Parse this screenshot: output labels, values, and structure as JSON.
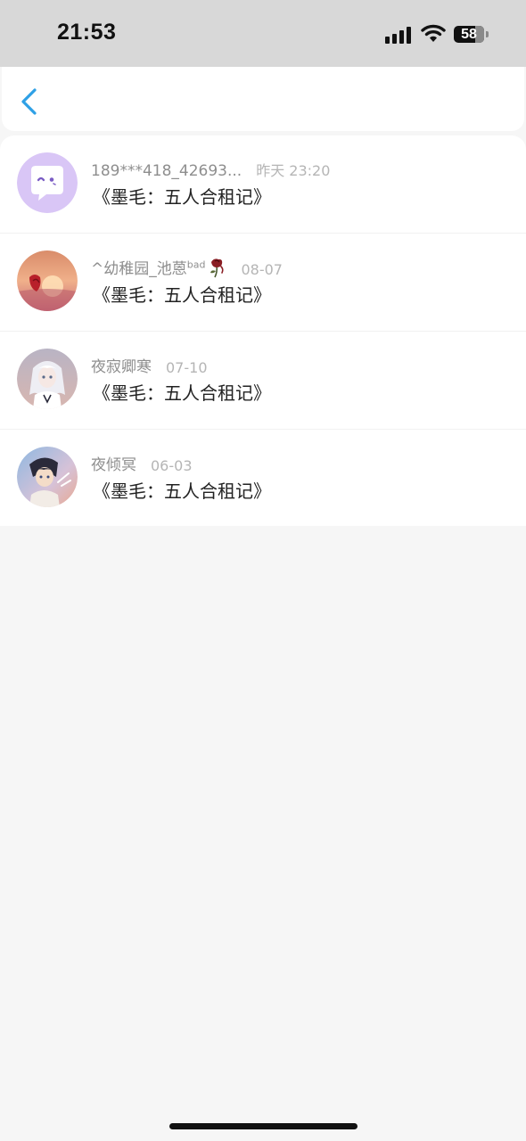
{
  "status_bar": {
    "time": "21:53",
    "battery_level": "58"
  },
  "nav": {
    "back_icon": "chevron-left-icon"
  },
  "items": [
    {
      "user": "189***418_42693...",
      "time": "昨天 23:20",
      "message": "《墨毛：五人合租记》",
      "avatar": "chat-bubble-face"
    },
    {
      "user": "^幼稚园_池蒽",
      "badge": "bad",
      "time": "08-07",
      "message": "《墨毛：五人合租记》",
      "avatar": "sunset-photo"
    },
    {
      "user": "夜寂卿寒",
      "time": "07-10",
      "message": "《墨毛：五人合租记》",
      "avatar": "anime-girl-photo"
    },
    {
      "user": "夜倾冥",
      "time": "06-03",
      "message": "《墨毛：五人合租记》",
      "avatar": "anime-boy-photo"
    }
  ],
  "colors": {
    "accent": "#2ea0e6",
    "avatar_bubble_bg": "#d9c6f6"
  }
}
